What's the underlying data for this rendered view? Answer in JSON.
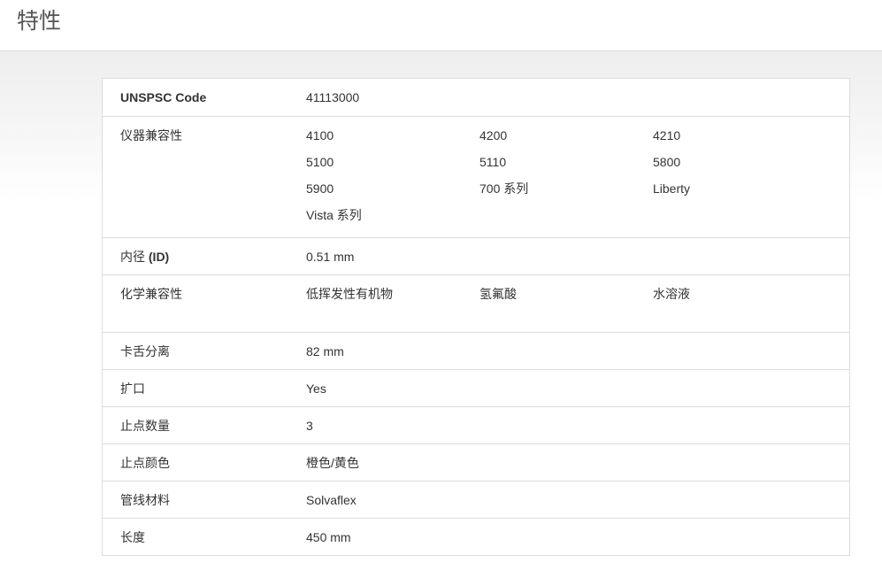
{
  "page": {
    "title": "特性"
  },
  "specs": {
    "unspsc": {
      "label": "UNSPSC Code",
      "value": "41113000"
    },
    "instrument_compat": {
      "label": "仪器兼容性",
      "values": [
        "4100",
        "4200",
        "4210",
        "5100",
        "5110",
        "5800",
        "5900",
        "700 系列",
        "Liberty",
        "Vista 系列"
      ]
    },
    "inner_diameter": {
      "label_prefix": "内径 ",
      "label_bold": "(ID)",
      "value": "0.51 mm"
    },
    "chemical_compat": {
      "label": "化学兼容性",
      "values": [
        "低挥发性有机物",
        "氢氟酸",
        "水溶液"
      ]
    },
    "bridge_separation": {
      "label": "卡舌分离",
      "value": "82 mm"
    },
    "flared": {
      "label": "扩口",
      "value": "Yes"
    },
    "stop_count": {
      "label": "止点数量",
      "value": "3"
    },
    "stop_color": {
      "label": "止点颜色",
      "value": "橙色/黄色"
    },
    "tubing_material": {
      "label": "管线材料",
      "value": "Solvaflex"
    },
    "length": {
      "label": "长度",
      "value": "450 mm"
    }
  },
  "colors": {
    "border": "#dcdcdc",
    "text": "#333333",
    "title": "#555555"
  }
}
